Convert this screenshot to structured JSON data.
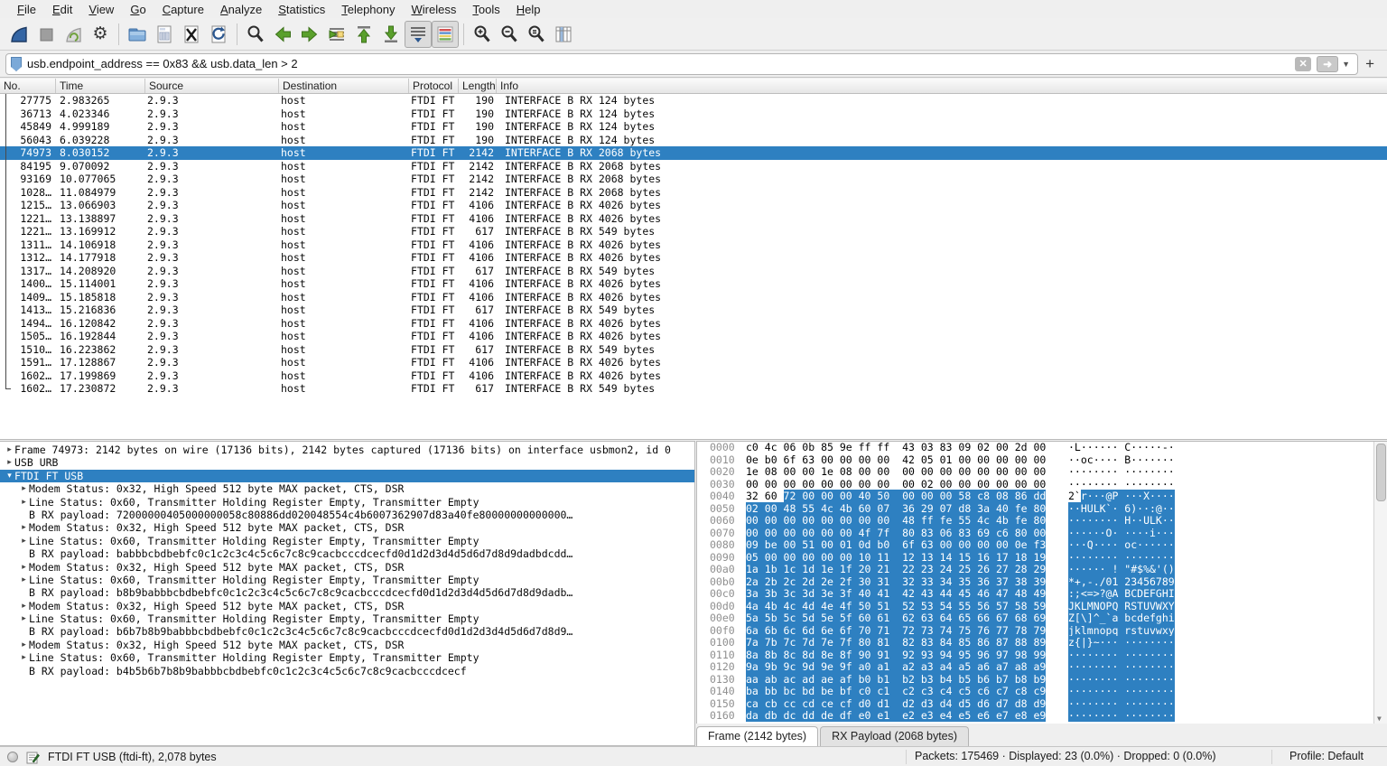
{
  "colors": {
    "selection_blue": "#2e80c1",
    "fin_blue": "#3465a4",
    "arrow_green": "#5aa02c"
  },
  "menu": {
    "items": [
      "File",
      "Edit",
      "View",
      "Go",
      "Capture",
      "Analyze",
      "Statistics",
      "Telephony",
      "Wireless",
      "Tools",
      "Help"
    ]
  },
  "toolbar": {
    "buttons": [
      "start-capture",
      "stop-capture",
      "restart-capture",
      "capture-options",
      "open-file",
      "save-file",
      "close-file",
      "reload-file",
      "find-packet",
      "go-back",
      "go-forward",
      "go-to-packet",
      "go-first",
      "go-last",
      "auto-scroll",
      "colorize",
      "zoom-in",
      "zoom-out",
      "zoom-normal",
      "resize-columns"
    ]
  },
  "filter": {
    "value": "usb.endpoint_address == 0x83 && usb.data_len > 2",
    "clear_label": "✕",
    "apply_label": "➜",
    "caret": "▼",
    "add_label": "+"
  },
  "packet_list": {
    "columns": [
      "No.",
      "Time",
      "Source",
      "Destination",
      "Protocol",
      "Length",
      "Info"
    ],
    "selected_index": 4,
    "rows": [
      [
        "27775",
        "2.983265",
        "2.9.3",
        "host",
        "FTDI FT",
        "190",
        "INTERFACE B RX 124 bytes"
      ],
      [
        "36713",
        "4.023346",
        "2.9.3",
        "host",
        "FTDI FT",
        "190",
        "INTERFACE B RX 124 bytes"
      ],
      [
        "45849",
        "4.999189",
        "2.9.3",
        "host",
        "FTDI FT",
        "190",
        "INTERFACE B RX 124 bytes"
      ],
      [
        "56043",
        "6.039228",
        "2.9.3",
        "host",
        "FTDI FT",
        "190",
        "INTERFACE B RX 124 bytes"
      ],
      [
        "74973",
        "8.030152",
        "2.9.3",
        "host",
        "FTDI FT",
        "2142",
        "INTERFACE B RX 2068 bytes"
      ],
      [
        "84195",
        "9.070092",
        "2.9.3",
        "host",
        "FTDI FT",
        "2142",
        "INTERFACE B RX 2068 bytes"
      ],
      [
        "93169",
        "10.077065",
        "2.9.3",
        "host",
        "FTDI FT",
        "2142",
        "INTERFACE B RX 2068 bytes"
      ],
      [
        "1028…",
        "11.084979",
        "2.9.3",
        "host",
        "FTDI FT",
        "2142",
        "INTERFACE B RX 2068 bytes"
      ],
      [
        "1215…",
        "13.066903",
        "2.9.3",
        "host",
        "FTDI FT",
        "4106",
        "INTERFACE B RX 4026 bytes"
      ],
      [
        "1221…",
        "13.138897",
        "2.9.3",
        "host",
        "FTDI FT",
        "4106",
        "INTERFACE B RX 4026 bytes"
      ],
      [
        "1221…",
        "13.169912",
        "2.9.3",
        "host",
        "FTDI FT",
        "617",
        "INTERFACE B RX 549 bytes"
      ],
      [
        "1311…",
        "14.106918",
        "2.9.3",
        "host",
        "FTDI FT",
        "4106",
        "INTERFACE B RX 4026 bytes"
      ],
      [
        "1312…",
        "14.177918",
        "2.9.3",
        "host",
        "FTDI FT",
        "4106",
        "INTERFACE B RX 4026 bytes"
      ],
      [
        "1317…",
        "14.208920",
        "2.9.3",
        "host",
        "FTDI FT",
        "617",
        "INTERFACE B RX 549 bytes"
      ],
      [
        "1400…",
        "15.114001",
        "2.9.3",
        "host",
        "FTDI FT",
        "4106",
        "INTERFACE B RX 4026 bytes"
      ],
      [
        "1409…",
        "15.185818",
        "2.9.3",
        "host",
        "FTDI FT",
        "4106",
        "INTERFACE B RX 4026 bytes"
      ],
      [
        "1413…",
        "15.216836",
        "2.9.3",
        "host",
        "FTDI FT",
        "617",
        "INTERFACE B RX 549 bytes"
      ],
      [
        "1494…",
        "16.120842",
        "2.9.3",
        "host",
        "FTDI FT",
        "4106",
        "INTERFACE B RX 4026 bytes"
      ],
      [
        "1505…",
        "16.192844",
        "2.9.3",
        "host",
        "FTDI FT",
        "4106",
        "INTERFACE B RX 4026 bytes"
      ],
      [
        "1510…",
        "16.223862",
        "2.9.3",
        "host",
        "FTDI FT",
        "617",
        "INTERFACE B RX 549 bytes"
      ],
      [
        "1591…",
        "17.128867",
        "2.9.3",
        "host",
        "FTDI FT",
        "4106",
        "INTERFACE B RX 4026 bytes"
      ],
      [
        "1602…",
        "17.199869",
        "2.9.3",
        "host",
        "FTDI FT",
        "4106",
        "INTERFACE B RX 4026 bytes"
      ],
      [
        "1602…",
        "17.230872",
        "2.9.3",
        "host",
        "FTDI FT",
        "617",
        "INTERFACE B RX 549 bytes"
      ]
    ]
  },
  "details": {
    "rows": [
      {
        "indent": 0,
        "expander": "collapsed",
        "selected": false,
        "text": "Frame 74973: 2142 bytes on wire (17136 bits), 2142 bytes captured (17136 bits) on interface usbmon2, id 0"
      },
      {
        "indent": 0,
        "expander": "collapsed",
        "selected": false,
        "text": "USB URB"
      },
      {
        "indent": 0,
        "expander": "expanded",
        "selected": true,
        "text": "FTDI FT USB"
      },
      {
        "indent": 1,
        "expander": "collapsed",
        "selected": false,
        "text": "Modem Status: 0x32, High Speed 512 byte MAX packet, CTS, DSR"
      },
      {
        "indent": 1,
        "expander": "collapsed",
        "selected": false,
        "text": "Line Status: 0x60, Transmitter Holding Register Empty, Transmitter Empty"
      },
      {
        "indent": 1,
        "expander": "none",
        "selected": false,
        "text": "B RX payload: 72000000405000000058c80886dd020048554c4b6007362907d83a40fe80000000000000…"
      },
      {
        "indent": 1,
        "expander": "collapsed",
        "selected": false,
        "text": "Modem Status: 0x32, High Speed 512 byte MAX packet, CTS, DSR"
      },
      {
        "indent": 1,
        "expander": "collapsed",
        "selected": false,
        "text": "Line Status: 0x60, Transmitter Holding Register Empty, Transmitter Empty"
      },
      {
        "indent": 1,
        "expander": "none",
        "selected": false,
        "text": "B RX payload: babbbcbdbebfc0c1c2c3c4c5c6c7c8c9cacbcccdcecfd0d1d2d3d4d5d6d7d8d9dadbdcdd…"
      },
      {
        "indent": 1,
        "expander": "collapsed",
        "selected": false,
        "text": "Modem Status: 0x32, High Speed 512 byte MAX packet, CTS, DSR"
      },
      {
        "indent": 1,
        "expander": "collapsed",
        "selected": false,
        "text": "Line Status: 0x60, Transmitter Holding Register Empty, Transmitter Empty"
      },
      {
        "indent": 1,
        "expander": "none",
        "selected": false,
        "text": "B RX payload: b8b9babbbcbdbebfc0c1c2c3c4c5c6c7c8c9cacbcccdcecfd0d1d2d3d4d5d6d7d8d9dadb…"
      },
      {
        "indent": 1,
        "expander": "collapsed",
        "selected": false,
        "text": "Modem Status: 0x32, High Speed 512 byte MAX packet, CTS, DSR"
      },
      {
        "indent": 1,
        "expander": "collapsed",
        "selected": false,
        "text": "Line Status: 0x60, Transmitter Holding Register Empty, Transmitter Empty"
      },
      {
        "indent": 1,
        "expander": "none",
        "selected": false,
        "text": "B RX payload: b6b7b8b9babbbcbdbebfc0c1c2c3c4c5c6c7c8c9cacbcccdcecfd0d1d2d3d4d5d6d7d8d9…"
      },
      {
        "indent": 1,
        "expander": "collapsed",
        "selected": false,
        "text": "Modem Status: 0x32, High Speed 512 byte MAX packet, CTS, DSR"
      },
      {
        "indent": 1,
        "expander": "collapsed",
        "selected": false,
        "text": "Line Status: 0x60, Transmitter Holding Register Empty, Transmitter Empty"
      },
      {
        "indent": 1,
        "expander": "none",
        "selected": false,
        "text": "B RX payload: b4b5b6b7b8b9babbbcbdbebfc0c1c2c3c4c5c6c7c8c9cacbcccdcecf"
      }
    ]
  },
  "hex": {
    "rows": [
      {
        "offset": "0000",
        "hex": "c0 4c 06 0b 85 9e ff ff  43 03 83 09 02 00 2d 00",
        "ascii": "·L······ C·····-·",
        "sel": false
      },
      {
        "offset": "0010",
        "hex": "0e b0 6f 63 00 00 00 00  42 05 01 00 00 00 00 00",
        "ascii": "··oc···· B·······",
        "sel": false
      },
      {
        "offset": "0020",
        "hex": "1e 08 00 00 1e 08 00 00  00 00 00 00 00 00 00 00",
        "ascii": "········ ········",
        "sel": false
      },
      {
        "offset": "0030",
        "hex": "00 00 00 00 00 00 00 00  00 02 00 00 00 00 00 00",
        "ascii": "········ ········",
        "sel": false
      },
      {
        "offset": "0040",
        "hex_pre": "32 60 ",
        "hex": "72 00 00 00 40 50  00 00 00 58 c8 08 86 dd",
        "ascii_pre": "2`",
        "ascii": "r···@P ···X····",
        "sel": true
      },
      {
        "offset": "0050",
        "hex": "02 00 48 55 4c 4b 60 07  36 29 07 d8 3a 40 fe 80",
        "ascii": "··HULK`· 6)··:@··",
        "sel": true
      },
      {
        "offset": "0060",
        "hex": "00 00 00 00 00 00 00 00  48 ff fe 55 4c 4b fe 80",
        "ascii": "········ H··ULK··",
        "sel": true
      },
      {
        "offset": "0070",
        "hex": "00 00 00 00 00 00 4f 7f  80 83 06 83 69 c6 80 00",
        "ascii": "······O· ····i···",
        "sel": true
      },
      {
        "offset": "0080",
        "hex": "09 be 00 51 00 01 0d b0  6f 63 00 00 00 00 0e f3",
        "ascii": "···Q···· oc······",
        "sel": true
      },
      {
        "offset": "0090",
        "hex": "05 00 00 00 00 00 10 11  12 13 14 15 16 17 18 19",
        "ascii": "········ ········",
        "sel": true
      },
      {
        "offset": "00a0",
        "hex": "1a 1b 1c 1d 1e 1f 20 21  22 23 24 25 26 27 28 29",
        "ascii": "······ ! \"#$%&'()",
        "sel": true
      },
      {
        "offset": "00b0",
        "hex": "2a 2b 2c 2d 2e 2f 30 31  32 33 34 35 36 37 38 39",
        "ascii": "*+,-./01 23456789",
        "sel": true
      },
      {
        "offset": "00c0",
        "hex": "3a 3b 3c 3d 3e 3f 40 41  42 43 44 45 46 47 48 49",
        "ascii": ":;<=>?@A BCDEFGHI",
        "sel": true
      },
      {
        "offset": "00d0",
        "hex": "4a 4b 4c 4d 4e 4f 50 51  52 53 54 55 56 57 58 59",
        "ascii": "JKLMNOPQ RSTUVWXY",
        "sel": true
      },
      {
        "offset": "00e0",
        "hex": "5a 5b 5c 5d 5e 5f 60 61  62 63 64 65 66 67 68 69",
        "ascii": "Z[\\]^_`a bcdefghi",
        "sel": true
      },
      {
        "offset": "00f0",
        "hex": "6a 6b 6c 6d 6e 6f 70 71  72 73 74 75 76 77 78 79",
        "ascii": "jklmnopq rstuvwxy",
        "sel": true
      },
      {
        "offset": "0100",
        "hex": "7a 7b 7c 7d 7e 7f 80 81  82 83 84 85 86 87 88 89",
        "ascii": "z{|}~··· ········",
        "sel": true
      },
      {
        "offset": "0110",
        "hex": "8a 8b 8c 8d 8e 8f 90 91  92 93 94 95 96 97 98 99",
        "ascii": "········ ········",
        "sel": true
      },
      {
        "offset": "0120",
        "hex": "9a 9b 9c 9d 9e 9f a0 a1  a2 a3 a4 a5 a6 a7 a8 a9",
        "ascii": "········ ········",
        "sel": true
      },
      {
        "offset": "0130",
        "hex": "aa ab ac ad ae af b0 b1  b2 b3 b4 b5 b6 b7 b8 b9",
        "ascii": "········ ········",
        "sel": true
      },
      {
        "offset": "0140",
        "hex": "ba bb bc bd be bf c0 c1  c2 c3 c4 c5 c6 c7 c8 c9",
        "ascii": "········ ········",
        "sel": true
      },
      {
        "offset": "0150",
        "hex": "ca cb cc cd ce cf d0 d1  d2 d3 d4 d5 d6 d7 d8 d9",
        "ascii": "········ ········",
        "sel": true
      },
      {
        "offset": "0160",
        "hex": "da db dc dd de df e0 e1  e2 e3 e4 e5 e6 e7 e8 e9",
        "ascii": "········ ········",
        "sel": true
      }
    ]
  },
  "byte_tabs": [
    {
      "label": "Frame (2142 bytes)",
      "active": true
    },
    {
      "label": "RX Payload (2068 bytes)",
      "active": false
    }
  ],
  "status_bar": {
    "left": "FTDI FT USB (ftdi-ft), 2,078 bytes",
    "center": "Packets: 175469 · Displayed: 23 (0.0%) · Dropped: 0 (0.0%)",
    "right": "Profile: Default"
  }
}
